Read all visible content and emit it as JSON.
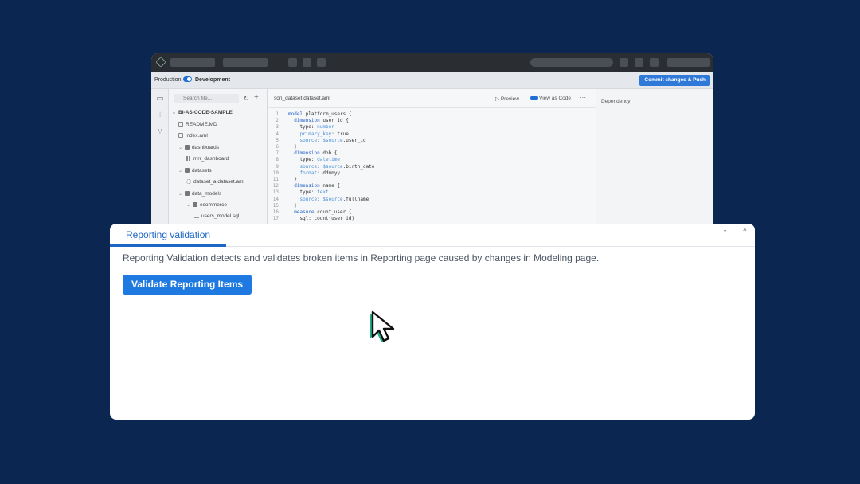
{
  "app": {
    "env": {
      "production": "Production",
      "development": "Development"
    },
    "commit_label": "Commit changes & Push",
    "filetree": {
      "search_placeholder": "Search file...",
      "items": [
        {
          "label": "BI-AS-CODE-SAMPLE",
          "icon": "chevron-down-icon"
        },
        {
          "label": "README.MD",
          "icon": "file-icon"
        },
        {
          "label": "index.aml",
          "icon": "file-icon"
        },
        {
          "label": "dashboards",
          "icon": "folder-icon"
        },
        {
          "label": "mrr_dashboard",
          "icon": "dashboard-icon"
        },
        {
          "label": "datasets",
          "icon": "folder-icon"
        },
        {
          "label": "dataset_a.dataset.aml",
          "icon": "dataset-icon"
        },
        {
          "label": "data_models",
          "icon": "folder-icon"
        },
        {
          "label": "ecommerce",
          "icon": "folder-icon"
        },
        {
          "label": "users_model.sql",
          "icon": "model-icon"
        }
      ]
    },
    "editor": {
      "tab": "son_dataset.dataset.aml",
      "preview": "Preview",
      "view_as_code": "View as Code",
      "lines": [
        "model platform_users {",
        "  dimension user_id {",
        "    type: number",
        "    primary_key: true",
        "    source: $source.user_id",
        "  }",
        "  dimension dob {",
        "    type: datetime",
        "    source: $source.birth_date",
        "    format: ddmmyy",
        "  }",
        "  dimension name {",
        "    type: text",
        "    source: $source.fullname",
        "  }",
        "  measure count_user {",
        "    sql: count(user_id)"
      ]
    },
    "dependency_label": "Dependency"
  },
  "dialog": {
    "tab": "Reporting validation",
    "description": "Reporting Validation detects and validates broken items in Reporting page caused by changes in Modeling page.",
    "button": "Validate Reporting Items"
  },
  "colors": {
    "background": "#0b2751",
    "accent": "#1e7ae0",
    "cursor_shadow": "#1fae85"
  }
}
